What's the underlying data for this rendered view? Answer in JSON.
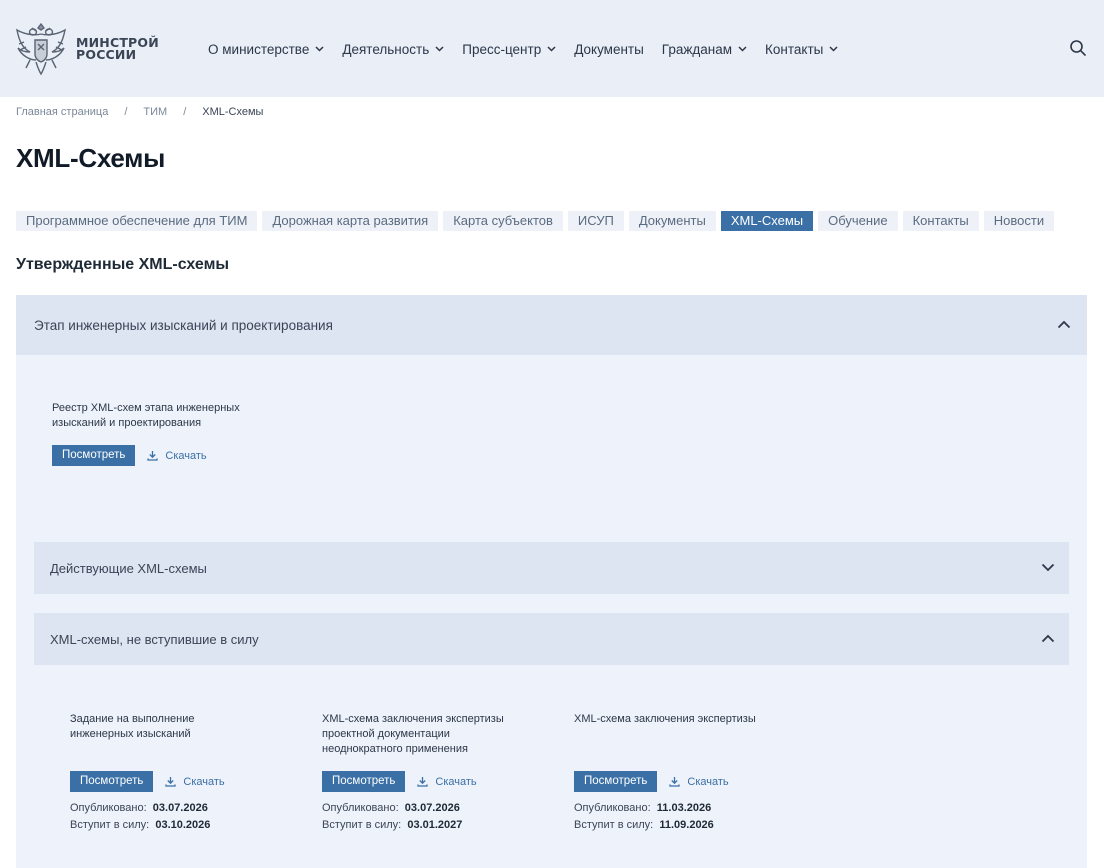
{
  "header": {
    "logo_line1": "МИНСТРОЙ",
    "logo_line2": "РОССИИ",
    "nav": [
      {
        "label": "О министерстве",
        "dropdown": true
      },
      {
        "label": "Деятельность",
        "dropdown": true
      },
      {
        "label": "Пресс-центр",
        "dropdown": true
      },
      {
        "label": "Документы",
        "dropdown": false
      },
      {
        "label": "Гражданам",
        "dropdown": true
      },
      {
        "label": "Контакты",
        "dropdown": true
      }
    ],
    "search_icon": "search-icon"
  },
  "breadcrumb": {
    "items": [
      "Главная страница",
      "ТИМ",
      "XML-Схемы"
    ],
    "separator": "/"
  },
  "page_title": "XML-Схемы",
  "tabs": [
    {
      "label": "Программное обеспечение для ТИМ",
      "active": false
    },
    {
      "label": "Дорожная карта развития",
      "active": false
    },
    {
      "label": "Карта субъектов",
      "active": false
    },
    {
      "label": "ИСУП",
      "active": false
    },
    {
      "label": "Документы",
      "active": false
    },
    {
      "label": "XML-Схемы",
      "active": true
    },
    {
      "label": "Обучение",
      "active": false
    },
    {
      "label": "Контакты",
      "active": false
    },
    {
      "label": "Новости",
      "active": false
    }
  ],
  "section_title": "Утвержденные XML-схемы",
  "accordion": {
    "title": "Этап инженерных изысканий и проектирования",
    "expanded": true,
    "registry": {
      "title_line1": "Реестр XML-схем этапа инженерных",
      "title_line2": "изысканий и проектирования",
      "view_label": "Посмотреть",
      "download_label": "Скачать"
    },
    "sub_active": {
      "title": "Действующие XML-схемы",
      "expanded": false
    },
    "sub_pending": {
      "title": "XML-схемы, не вступившие в силу",
      "expanded": true,
      "published_label": "Опубликовано:",
      "effective_label": "Вступит в силу:",
      "view_label": "Посмотреть",
      "download_label": "Скачать",
      "docs": [
        {
          "title_lines": [
            "Задание на выполнение",
            "инженерных изысканий",
            ""
          ],
          "published": "03.07.2026",
          "effective": "03.10.2026"
        },
        {
          "title_lines": [
            "XML-схема заключения экспертизы",
            "проектной документации",
            "неоднократного применения"
          ],
          "published": "03.07.2026",
          "effective": "03.01.2027"
        },
        {
          "title_lines": [
            "XML-схема заключения экспертизы",
            "",
            ""
          ],
          "published": "11.03.2026",
          "effective": "11.09.2026"
        }
      ]
    }
  },
  "colors": {
    "header_bg": "#e9eef7",
    "accent": "#3a70a6",
    "accordion_head": "#dde4f2",
    "accordion_body": "#eef2fa",
    "tab_bg": "#eef2f8"
  }
}
